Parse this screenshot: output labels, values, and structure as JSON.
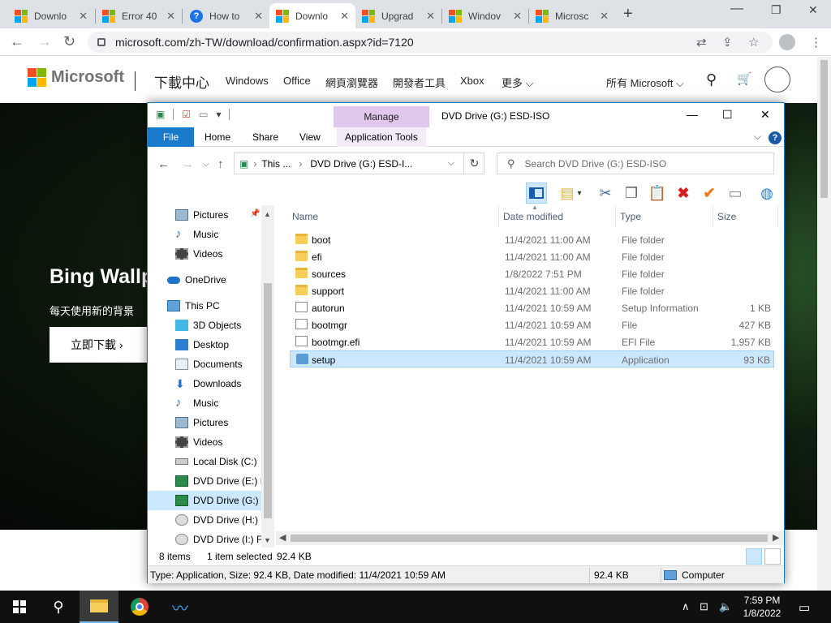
{
  "browser": {
    "tabs": [
      {
        "label": "Downlo",
        "favicon": "microsoft-logo"
      },
      {
        "label": "Error 40",
        "favicon": "microsoft-logo"
      },
      {
        "label": "How to",
        "favicon": "help-icon"
      },
      {
        "label": "Downlo",
        "favicon": "microsoft-logo",
        "active": true
      },
      {
        "label": "Upgrad",
        "favicon": "microsoft-logo"
      },
      {
        "label": "Windov",
        "favicon": "microsoft-logo"
      },
      {
        "label": "Microsc",
        "favicon": "microsoft-logo"
      }
    ],
    "url": "microsoft.com/zh-TW/download/confirmation.aspx?id=7120"
  },
  "site": {
    "brand": "Microsoft",
    "section_title": "下載中心",
    "nav": [
      "Windows",
      "Office",
      "網頁瀏覽器",
      "開發者工具",
      "Xbox",
      "更多"
    ],
    "all_microsoft": "所有 Microsoft",
    "hero_title": "Bing Wallp",
    "hero_subtitle": "每天使用新的背景",
    "hero_button": "立即下載"
  },
  "explorer": {
    "manage_tab": "Manage",
    "window_title": "DVD Drive (G:) ESD-ISO",
    "ribbon_tabs": [
      "File",
      "Home",
      "Share",
      "View",
      "Application Tools"
    ],
    "address": {
      "seg1": "This ...",
      "seg2": "DVD Drive (G:) ESD-I..."
    },
    "search_placeholder": "Search DVD Drive (G:) ESD-ISO",
    "nav_items": [
      {
        "label": "Pictures",
        "icon": "pictures-icon",
        "pinned": true
      },
      {
        "label": "Music",
        "icon": "music-icon"
      },
      {
        "label": "Videos",
        "icon": "videos-icon"
      },
      {
        "label": "OneDrive",
        "icon": "onedrive-icon"
      },
      {
        "label": "This PC",
        "icon": "this-pc-icon"
      },
      {
        "label": "3D Objects",
        "icon": "3d-objects-icon"
      },
      {
        "label": "Desktop",
        "icon": "desktop-icon"
      },
      {
        "label": "Documents",
        "icon": "documents-icon"
      },
      {
        "label": "Downloads",
        "icon": "downloads-icon"
      },
      {
        "label": "Music",
        "icon": "music-icon"
      },
      {
        "label": "Pictures",
        "icon": "pictures-icon"
      },
      {
        "label": "Videos",
        "icon": "videos-icon"
      },
      {
        "label": "Local Disk (C:)",
        "icon": "disk-icon"
      },
      {
        "label": "DVD Drive (E:) IR",
        "icon": "dvd-icon"
      },
      {
        "label": "DVD Drive (G:) ES",
        "icon": "dvd-icon",
        "selected": true
      },
      {
        "label": "DVD Drive (H:) F",
        "icon": "dvd-icon"
      },
      {
        "label": "DVD Drive (I:) FR",
        "icon": "dvd-icon"
      }
    ],
    "columns": [
      "Name",
      "Date modified",
      "Type",
      "Size"
    ],
    "files": [
      {
        "name": "boot",
        "date": "11/4/2021 11:00 AM",
        "type": "File folder",
        "size": "",
        "icon": "folder-icon"
      },
      {
        "name": "efi",
        "date": "11/4/2021 11:00 AM",
        "type": "File folder",
        "size": "",
        "icon": "folder-icon"
      },
      {
        "name": "sources",
        "date": "1/8/2022 7:51 PM",
        "type": "File folder",
        "size": "",
        "icon": "folder-icon"
      },
      {
        "name": "support",
        "date": "11/4/2021 11:00 AM",
        "type": "File folder",
        "size": "",
        "icon": "folder-icon"
      },
      {
        "name": "autorun",
        "date": "11/4/2021 10:59 AM",
        "type": "Setup Information",
        "size": "1 KB",
        "icon": "setup-info-icon"
      },
      {
        "name": "bootmgr",
        "date": "11/4/2021 10:59 AM",
        "type": "File",
        "size": "427 KB",
        "icon": "file-icon"
      },
      {
        "name": "bootmgr.efi",
        "date": "11/4/2021 10:59 AM",
        "type": "EFI File",
        "size": "1,957 KB",
        "icon": "file-icon"
      },
      {
        "name": "setup",
        "date": "11/4/2021 10:59 AM",
        "type": "Application",
        "size": "93 KB",
        "icon": "setup-app-icon",
        "selected": true
      }
    ],
    "status": {
      "items": "8 items",
      "selected": "1 item selected",
      "size": "92.4 KB"
    },
    "details_bar": {
      "info": "Type: Application, Size: 92.4 KB, Date modified: 11/4/2021 10:59 AM",
      "size": "92.4 KB",
      "location": "Computer"
    }
  },
  "taskbar": {
    "time": "7:59 PM",
    "date": "1/8/2022"
  },
  "colors": {
    "file_tab_blue": "#1979ca",
    "manage_purple": "#e1c7ec",
    "selection": "#cce8ff",
    "taskbar": "#101010"
  }
}
